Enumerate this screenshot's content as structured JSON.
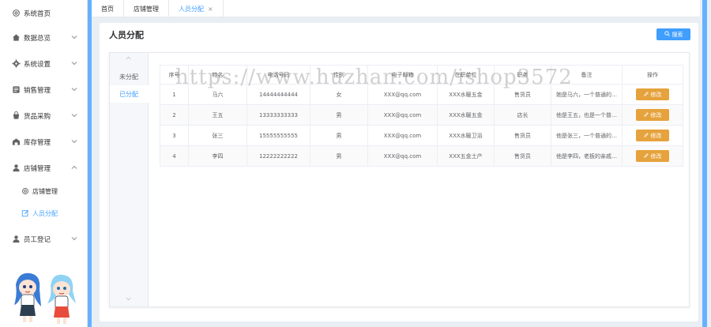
{
  "sidebar": {
    "items": [
      {
        "label": "系统首页",
        "icon": "gear-icon",
        "has_arrow": false
      },
      {
        "label": "数据总览",
        "icon": "home-icon",
        "has_arrow": true
      },
      {
        "label": "系统设置",
        "icon": "settings-icon",
        "has_arrow": true
      },
      {
        "label": "销售管理",
        "icon": "sales-icon",
        "has_arrow": true
      },
      {
        "label": "货品采购",
        "icon": "cart-icon",
        "has_arrow": true
      },
      {
        "label": "库存管理",
        "icon": "warehouse-icon",
        "has_arrow": true
      },
      {
        "label": "店铺管理",
        "icon": "user-icon",
        "has_arrow": true,
        "expanded": true
      },
      {
        "label": "员工登记",
        "icon": "user-icon",
        "has_arrow": true
      }
    ],
    "subitems": [
      {
        "label": "店铺管理",
        "icon": "gear-icon"
      },
      {
        "label": "人员分配",
        "icon": "edit-icon",
        "active": true
      }
    ]
  },
  "tabs": [
    {
      "label": "首页"
    },
    {
      "label": "店铺管理"
    },
    {
      "label": "人员分配",
      "active": true,
      "close": "×"
    }
  ],
  "page": {
    "title": "人员分配",
    "search_label": "搜索"
  },
  "side_tabs": [
    {
      "label": "未分配"
    },
    {
      "label": "已分配",
      "active": true
    }
  ],
  "table": {
    "headers": [
      "序号",
      "姓名",
      "电话号码",
      "性别",
      "电子邮箱",
      "在职单位",
      "职务",
      "备注",
      "操作"
    ],
    "rows": [
      [
        "1",
        "马六",
        "14444444444",
        "女",
        "XXX@qq.com",
        "XXX水暖五金",
        "售货员",
        "她是马六，一个普通的…",
        "修改"
      ],
      [
        "2",
        "王五",
        "13333333333",
        "男",
        "XXX@qq.com",
        "XXX水暖五金",
        "店长",
        "他是王五，也是一个普…",
        "修改"
      ],
      [
        "3",
        "张三",
        "15555555555",
        "男",
        "XXX@qq.com",
        "XXX水暖卫浴",
        "售货员",
        "他是张三，一个普通的…",
        "修改"
      ],
      [
        "4",
        "李四",
        "12222222222",
        "男",
        "XXX@qq.com",
        "XXX五金土产",
        "售货员",
        "他是李四，老板的亲戚…",
        "修改"
      ]
    ]
  },
  "watermark": "https://www.huzhan.com/ishop3572",
  "colors": {
    "accent": "#409eff",
    "warning": "#e6a23c",
    "stripe": "#66b1ff"
  }
}
